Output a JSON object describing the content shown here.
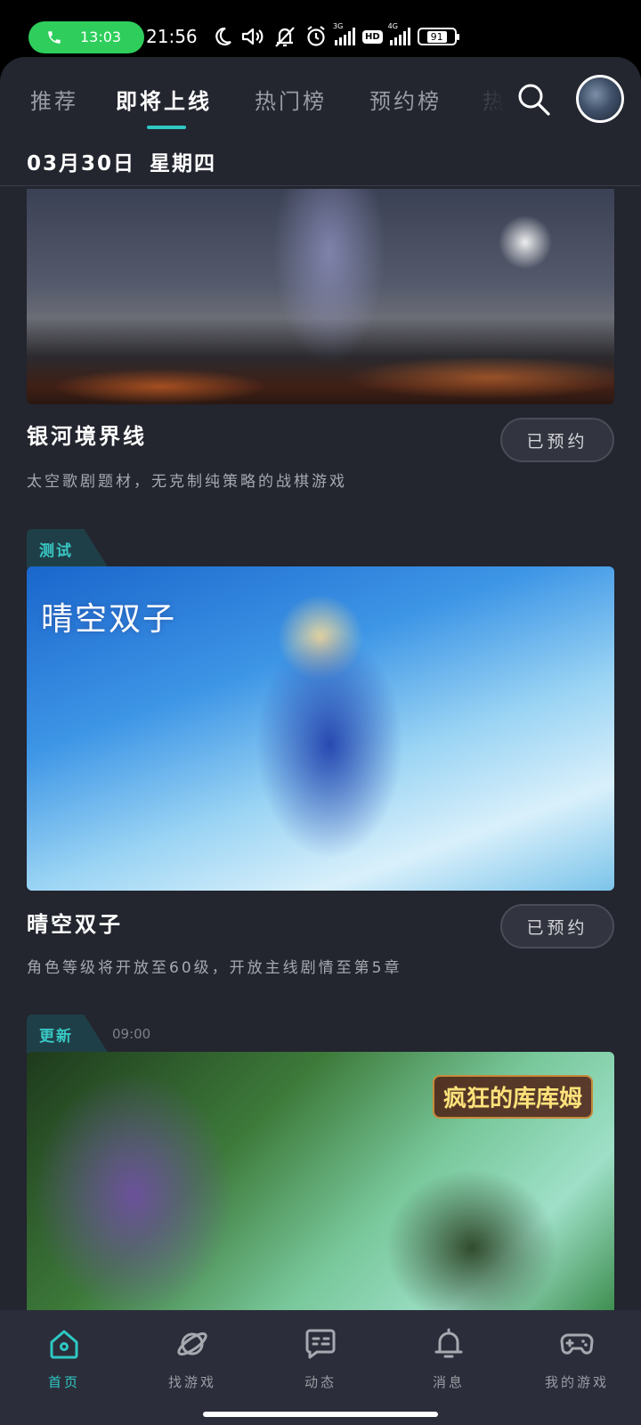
{
  "status_bar": {
    "call_time": "13:03",
    "time": "21:56",
    "network_1": "3G",
    "hd": "HD",
    "network_2": "4G",
    "battery": "91"
  },
  "tabs": [
    {
      "label": "推荐",
      "active": false
    },
    {
      "label": "即将上线",
      "active": true
    },
    {
      "label": "热门榜",
      "active": false
    },
    {
      "label": "预约榜",
      "active": false
    },
    {
      "label": "热",
      "active": false
    }
  ],
  "date": {
    "date": "03月30日",
    "weekday": "星期四"
  },
  "games": [
    {
      "title": "银河境界线",
      "description": "太空歌剧题材，无克制纯策略的战棋游戏",
      "button": "已预约"
    },
    {
      "tag": "测试",
      "logo": "晴空双子",
      "title": "晴空双子",
      "description": "角色等级将开放至60级，开放主线剧情至第5章",
      "button": "已预约"
    },
    {
      "tag": "更新",
      "time": "09:00",
      "logo": "疯狂的库库姆"
    }
  ],
  "bottom_nav": [
    {
      "label": "首页",
      "icon": "home-icon",
      "active": true
    },
    {
      "label": "找游戏",
      "icon": "planet-icon",
      "active": false
    },
    {
      "label": "动态",
      "icon": "chat-icon",
      "active": false
    },
    {
      "label": "消息",
      "icon": "bell-icon",
      "active": false
    },
    {
      "label": "我的游戏",
      "icon": "gamepad-icon",
      "active": false
    }
  ],
  "colors": {
    "accent": "#2fc8c4",
    "background": "#23252f",
    "nav_background": "#2b2e3a",
    "call_pill": "#2fce5c"
  }
}
